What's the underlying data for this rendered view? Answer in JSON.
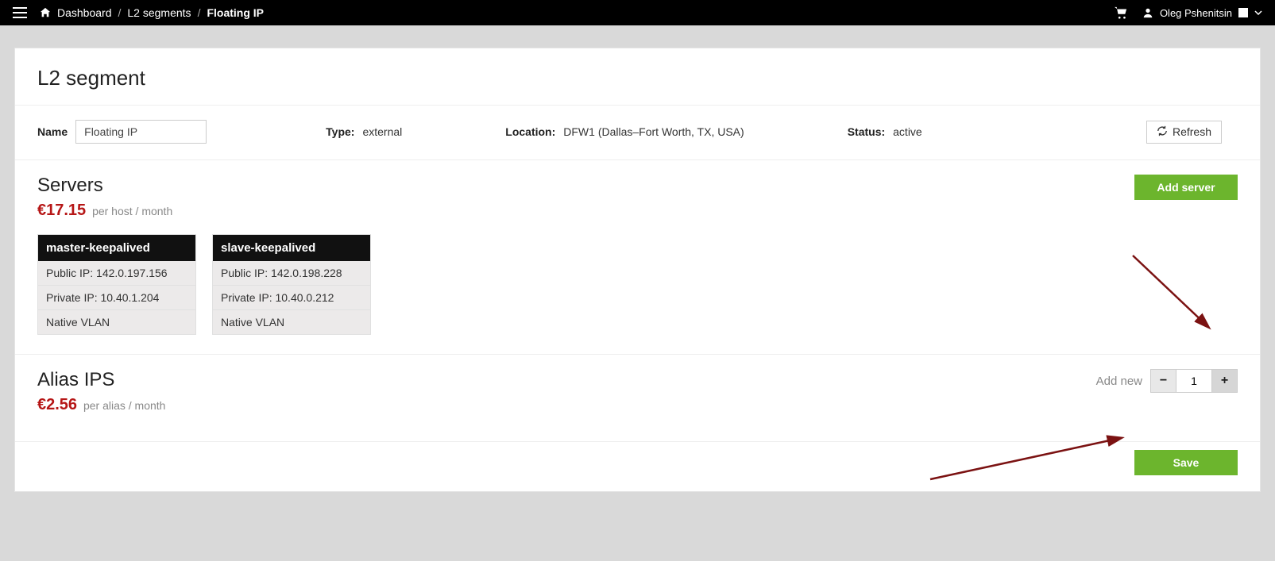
{
  "header": {
    "breadcrumb": {
      "home": "Dashboard",
      "l2": "L2 segments",
      "current": "Floating IP"
    },
    "user_name": "Oleg Pshenitsin"
  },
  "page": {
    "title": "L2 segment",
    "meta": {
      "name_label": "Name",
      "name_value": "Floating IP",
      "type_label": "Type:",
      "type_value": "external",
      "location_label": "Location:",
      "location_value": "DFW1 (Dallas–Fort Worth, TX, USA)",
      "status_label": "Status:",
      "status_value": "active",
      "refresh_label": "Refresh"
    },
    "servers": {
      "title": "Servers",
      "price": "€17.15",
      "price_unit": "per host / month",
      "add_button": "Add server",
      "cards": [
        {
          "name": "master-keepalived",
          "public_ip_label": "Public IP:",
          "public_ip": "142.0.197.156",
          "private_ip_label": "Private IP:",
          "private_ip": "10.40.1.204",
          "vlan": "Native VLAN"
        },
        {
          "name": "slave-keepalived",
          "public_ip_label": "Public IP:",
          "public_ip": "142.0.198.228",
          "private_ip_label": "Private IP:",
          "private_ip": "10.40.0.212",
          "vlan": "Native VLAN"
        }
      ]
    },
    "alias": {
      "title": "Alias IPS",
      "price": "€2.56",
      "price_unit": "per alias / month",
      "addnew_label": "Add new",
      "quantity": "1"
    },
    "save_label": "Save"
  }
}
